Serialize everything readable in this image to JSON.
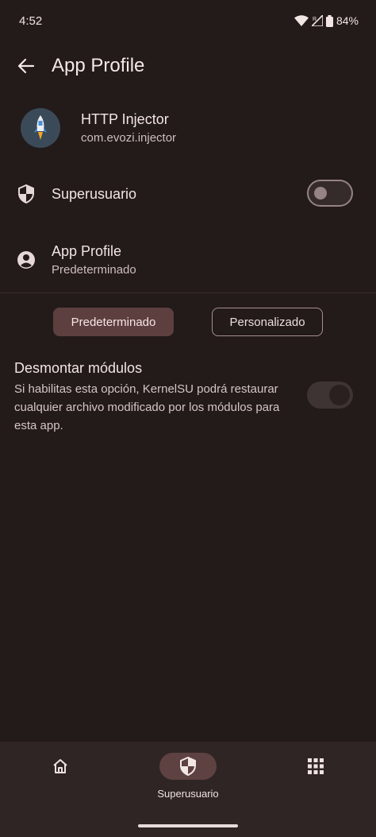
{
  "status_bar": {
    "time": "4:52",
    "battery": "84%"
  },
  "top_bar": {
    "title": "App Profile"
  },
  "app": {
    "name": "HTTP Injector",
    "package": "com.evozi.injector"
  },
  "superuser": {
    "label": "Superusuario",
    "enabled": false
  },
  "profile": {
    "title": "App Profile",
    "value": "Predeterminado"
  },
  "profile_options": {
    "selected": "Predeterminado",
    "other": "Personalizado"
  },
  "unmount": {
    "title": "Desmontar módulos",
    "description": "Si habilitas esta opción, KernelSU podrá restaurar cualquier archivo modificado por los módulos para esta app.",
    "enabled": true
  },
  "bottom_nav": {
    "items": [
      {
        "icon": "home-icon",
        "label": ""
      },
      {
        "icon": "shield-icon",
        "label": "Superusuario",
        "active": true
      },
      {
        "icon": "grid-icon",
        "label": ""
      }
    ]
  },
  "colors": {
    "background": "#231a1a",
    "accent": "#5e4141",
    "nav_background": "#302525"
  }
}
